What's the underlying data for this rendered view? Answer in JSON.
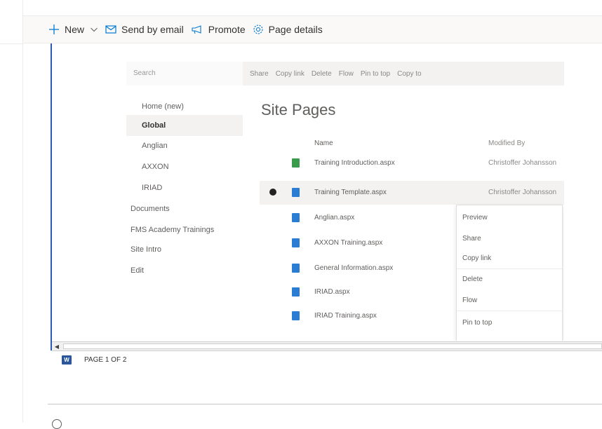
{
  "command_bar": {
    "new_label": "New",
    "send_email_label": "Send by email",
    "promote_label": "Promote",
    "page_details_label": "Page details"
  },
  "embedded_screenshot": {
    "search_placeholder": "Search",
    "toolbar": [
      "Share",
      "Copy link",
      "Delete",
      "Flow",
      "Pin to top",
      "Copy to"
    ],
    "nav_items": [
      "Home (new)",
      "Global",
      "Anglian",
      "AXXON",
      "IRIAD",
      "Documents",
      "FMS Academy Trainings",
      "Site Intro",
      "Edit"
    ],
    "title": "Site Pages",
    "column_name": "Name",
    "column_modified_by": "Modified By",
    "rows": [
      {
        "name": "Training Introduction.aspx",
        "modified": "Christoffer Johansson"
      },
      {
        "name": "Training Template.aspx",
        "modified": "Christoffer Johansson"
      },
      {
        "name": "Anglian.aspx",
        "modified": ""
      },
      {
        "name": "AXXON Training.aspx",
        "modified": ""
      },
      {
        "name": "General Information.aspx",
        "modified": ""
      },
      {
        "name": "IRIAD.aspx",
        "modified": ""
      },
      {
        "name": "IRIAD Training.aspx",
        "modified": ""
      }
    ],
    "context_menu": [
      "Preview",
      "Share",
      "Copy link",
      "Delete",
      "Flow",
      "Pin to top"
    ]
  },
  "status_bar": {
    "page_indicator": "PAGE 1 OF 2",
    "word_icon_text": "W"
  }
}
